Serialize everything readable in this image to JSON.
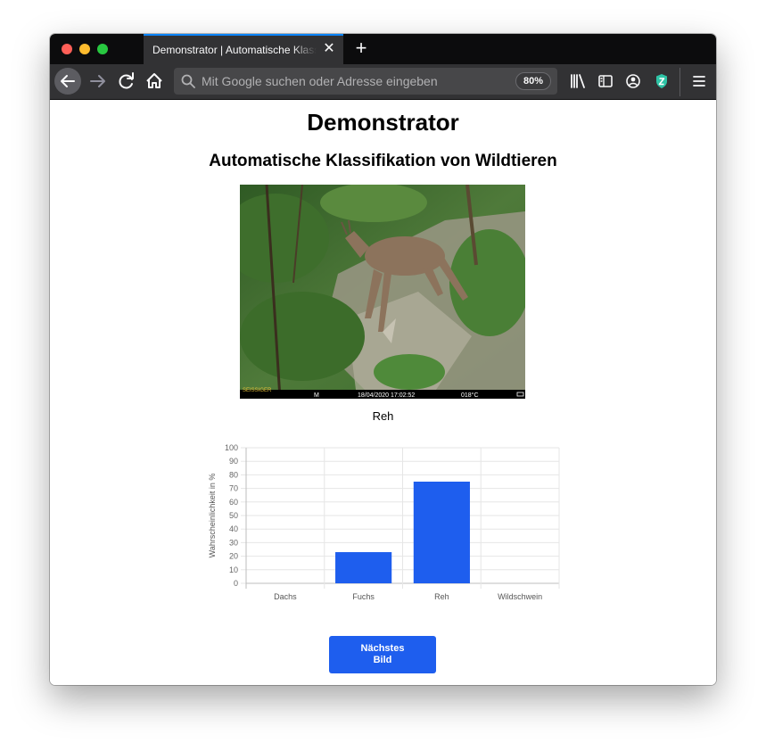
{
  "browser": {
    "tab_title": "Demonstrator | Automatische Klassifikation von Wildtieren",
    "url_placeholder": "Mit Google suchen oder Adresse eingeben",
    "zoom": "80%"
  },
  "page": {
    "title": "Demonstrator",
    "subtitle": "Automatische Klassifikation von Wildtieren",
    "image_overlay": {
      "brand": "SEISSIGER",
      "mode": "M",
      "datetime": "18/04/2020 17:02:52",
      "temperature": "018°C"
    },
    "prediction_label": "Reh",
    "next_button_label": "Nächstes\nBild"
  },
  "chart_data": {
    "type": "bar",
    "categories": [
      "Dachs",
      "Fuchs",
      "Reh",
      "Wildschwein"
    ],
    "values": [
      0,
      23,
      75,
      0
    ],
    "title": "",
    "xlabel": "",
    "ylabel": "Wahrscheinlichkeit in %",
    "ylim": [
      0,
      100
    ],
    "yticks": [
      0,
      10,
      20,
      30,
      40,
      50,
      60,
      70,
      80,
      90,
      100
    ],
    "grid": true,
    "bar_color": "#1e5eee"
  }
}
